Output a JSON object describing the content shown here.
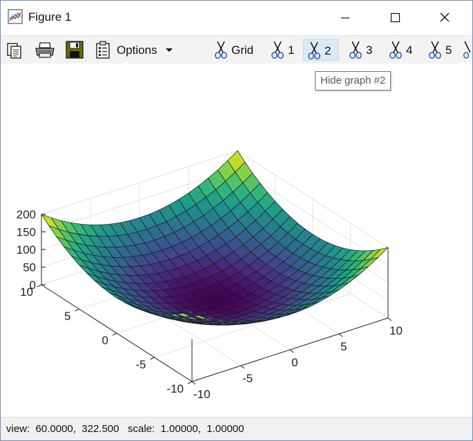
{
  "window": {
    "title": "Figure 1"
  },
  "toolbar": {
    "options_label": "Options",
    "grid_label": "Grid",
    "graph_toggles": [
      "1",
      "2",
      "3",
      "4",
      "5"
    ],
    "active_toggle": "2",
    "icons": [
      "copy-icon",
      "print-icon",
      "save-icon",
      "properties-icon",
      "scissors-icon"
    ]
  },
  "tooltip": {
    "text": "Hide graph #2"
  },
  "status": {
    "view_label": "view:",
    "view_values": "60.0000,  322.500",
    "scale_label": "scale:",
    "scale_values": "1.00000,  1.00000"
  },
  "chart_data": {
    "type": "surface",
    "function": "z = x^2 + y^2",
    "x_range": [
      -10,
      10
    ],
    "y_range": [
      -10,
      10
    ],
    "z_range": [
      0,
      200
    ],
    "grid_points": 21,
    "x_ticks": [
      "-10",
      "-5",
      "0",
      "5",
      "10"
    ],
    "y_ticks": [
      "-10",
      "-5",
      "0",
      "5",
      "10"
    ],
    "z_ticks": [
      "0",
      "50",
      "100",
      "150",
      "200"
    ],
    "colormap": "viridis",
    "box_grid": true
  }
}
